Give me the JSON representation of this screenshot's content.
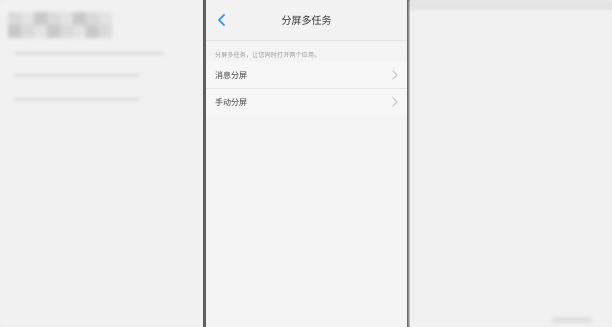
{
  "header": {
    "title": "分屏多任务"
  },
  "description": "分屏多任务，让您同时打开两个应用。",
  "items": [
    {
      "label": "消息分屏"
    },
    {
      "label": "手动分屏"
    }
  ],
  "icons": {
    "back": "chevron-left-icon",
    "item_arrow": "chevron-right-icon"
  },
  "colors": {
    "accent": "#3a8ee6",
    "background": "#f4f4f4"
  }
}
